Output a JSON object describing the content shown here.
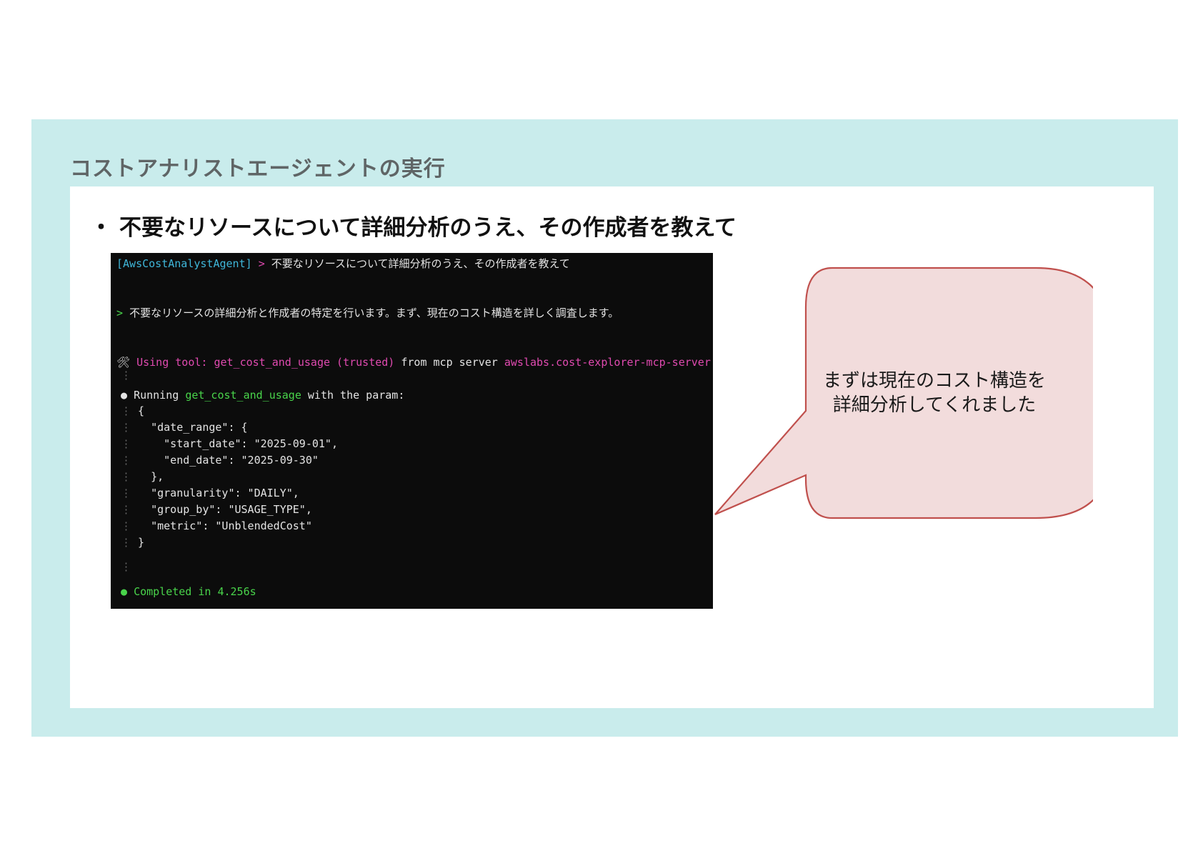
{
  "slide": {
    "title": "コストアナリストエージェントの実行",
    "bullet_marker": "・",
    "bullet_text": "不要なリソースについて詳細分析のうえ、その作成者を教えて"
  },
  "terminal": {
    "prompt_agent": "[AwsCostAnalystAgent]",
    "prompt_arrow": ">",
    "prompt_text": "不要なリソースについて詳細分析のうえ、その作成者を教えて",
    "response_arrow": ">",
    "response_text": "不要なリソースの詳細分析と作成者の特定を行います。まず、現在のコスト構造を詳しく調査します。",
    "tool_icon": "🛠",
    "tool_using": "Using tool:",
    "tool_name": "get_cost_and_usage",
    "tool_trusted": "(trusted)",
    "tool_from": "from mcp server",
    "tool_server": "awslabs.cost-explorer-mcp-server",
    "running_bullet": "●",
    "running_prefix": "Running",
    "running_tool": "get_cost_and_usage",
    "running_suffix": "with the param:",
    "params": [
      "{",
      "  \"date_range\": {",
      "    \"start_date\": \"2025-09-01\",",
      "    \"end_date\": \"2025-09-30\"",
      "  },",
      "  \"granularity\": \"DAILY\",",
      "  \"group_by\": \"USAGE_TYPE\",",
      "  \"metric\": \"UnblendedCost\"",
      "}"
    ],
    "completed_bullet": "●",
    "completed_text": "Completed in 4.256s"
  },
  "callout": {
    "line1": "まずは現在のコスト構造を",
    "line2": "詳細分析してくれました"
  },
  "colors": {
    "panel_bg": "#c9ecec",
    "terminal_bg": "#0c0c0c",
    "callout_fill": "#f2dcdc",
    "callout_stroke": "#c0504d"
  }
}
